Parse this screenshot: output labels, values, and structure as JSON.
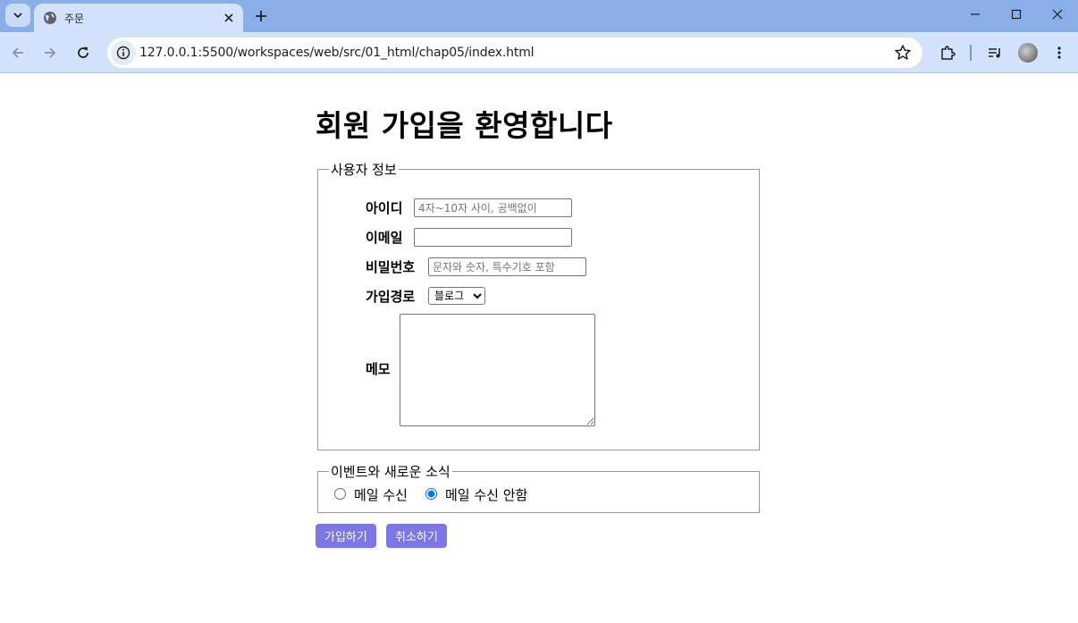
{
  "browser": {
    "tab_title": "주문",
    "url": "127.0.0.1:5500/workspaces/web/src/01_html/chap05/index.html",
    "accent_color": "#8aaee8"
  },
  "page": {
    "title": "회원 가입을 환영합니다",
    "user_info": {
      "legend": "사용자 정보",
      "id_label": "아이디",
      "id_placeholder": "4자~10자 사이, 공백없이",
      "email_label": "이메일",
      "email_value": "",
      "password_label": "비밀번호",
      "password_placeholder": "문자와 숫자, 특수기호 포함",
      "signup_path_label": "가입경로",
      "signup_path_selected": "블로그",
      "memo_label": "메모"
    },
    "events": {
      "legend": "이벤트와 새로운 소식",
      "option_receive": "메일 수신",
      "option_decline": "메일 수신 안함",
      "selected": "메일 수신 안함"
    },
    "buttons": {
      "submit": "가입하기",
      "cancel": "취소하기",
      "color": "#7b77e6"
    }
  }
}
